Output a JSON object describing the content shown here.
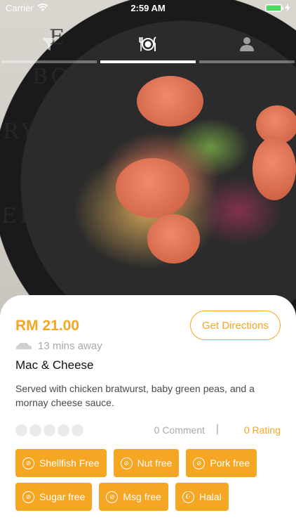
{
  "status": {
    "carrier": "Carrier",
    "time": "2:59 AM"
  },
  "tabs": [
    {
      "icon": "filter-icon",
      "active": false
    },
    {
      "icon": "plate-utensils-icon",
      "active": true
    },
    {
      "icon": "user-icon",
      "active": false
    }
  ],
  "hero": {
    "paper_letters": [
      "E",
      "BO",
      "RY",
      "ERY"
    ]
  },
  "dish": {
    "price": "RM 21.00",
    "directions_label": "Get Directions",
    "eta": "13 mins away",
    "name": "Mac & Cheese",
    "description": "Served with chicken bratwurst, baby green peas, and a mornay cheese sauce."
  },
  "rating": {
    "stars_filled": 0,
    "stars_total": 5,
    "comment": "0 Comment",
    "separator": "|",
    "rating": "0 Rating"
  },
  "tags": [
    {
      "label": "Shellfish Free",
      "icon": "no-shellfish-icon"
    },
    {
      "label": "Nut free",
      "icon": "no-nut-icon"
    },
    {
      "label": "Pork free",
      "icon": "no-pork-icon"
    },
    {
      "label": "Sugar free",
      "icon": "no-sugar-icon"
    },
    {
      "label": "Msg free",
      "icon": "no-msg-icon"
    },
    {
      "label": "Halal",
      "icon": "halal-icon"
    }
  ],
  "colors": {
    "accent": "#f5a623",
    "muted": "#a9a9a9"
  }
}
